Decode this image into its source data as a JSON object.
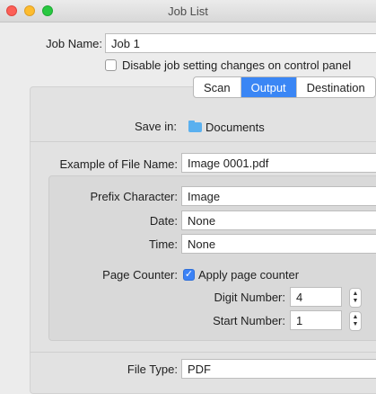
{
  "window": {
    "title": "Job List"
  },
  "job": {
    "name_label": "Job Name:",
    "name_value": "Job 1",
    "disable_label": "Disable job setting changes on control panel"
  },
  "tabs": [
    {
      "label": "Scan"
    },
    {
      "label": "Output"
    },
    {
      "label": "Destination"
    }
  ],
  "output": {
    "save_in_label": "Save in:",
    "save_in_value": "Documents",
    "example_label": "Example of File Name:",
    "example_value": "Image 0001.pdf",
    "prefix_label": "Prefix Character:",
    "prefix_value": "Image",
    "date_label": "Date:",
    "date_value": "None",
    "time_label": "Time:",
    "time_value": "None",
    "page_counter_label": "Page Counter:",
    "apply_counter_label": "Apply page counter",
    "digit_label": "Digit Number:",
    "digit_value": "4",
    "start_label": "Start Number:",
    "start_value": "1",
    "file_type_label": "File Type:",
    "file_type_value": "PDF"
  },
  "colors": {
    "accent": "#3a86f5",
    "close": "#fc5f57",
    "minimize": "#fdbc2e",
    "zoom": "#28c840"
  }
}
